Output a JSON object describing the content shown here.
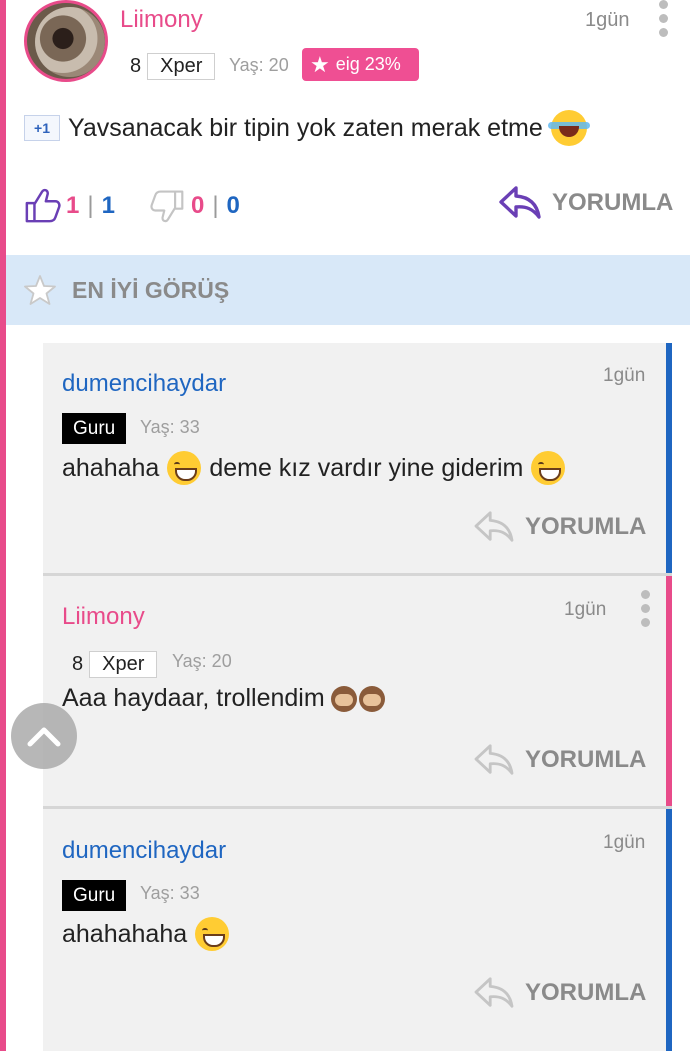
{
  "post": {
    "username": "Liimony",
    "time": "1gün",
    "level": "8",
    "rank": "Xper",
    "age": "Yaş: 20",
    "eig": "eig 23%",
    "plus_one": "+1",
    "text": "Yavsanacak bir tipin yok zaten merak etme",
    "likes_pink": "1",
    "likes_blue": "1",
    "dislikes_pink": "0",
    "dislikes_blue": "0",
    "separator": "|",
    "reply_label": "YORUMLA"
  },
  "best_opinion": {
    "label": "EN İYİ GÖRÜŞ"
  },
  "comments": [
    {
      "username": "dumencihaydar",
      "time": "1gün",
      "badge": "Guru",
      "age": "Yaş: 33",
      "text_a": "ahahaha",
      "text_b": "deme kız vardır yine giderim",
      "reply_label": "YORUMLA",
      "accent": "#1f66c1"
    },
    {
      "username": "Liimony",
      "time": "1gün",
      "level": "8",
      "rank": "Xper",
      "age": "Yaş: 20",
      "text": "Aaa haydaar, trollendim",
      "reply_label": "YORUMLA",
      "accent": "#e84b8a"
    },
    {
      "username": "dumencihaydar",
      "time": "1gün",
      "badge": "Guru",
      "age": "Yaş: 33",
      "text": "ahahahaha",
      "reply_label": "YORUMLA",
      "accent": "#1f66c1"
    }
  ],
  "icons": [
    "avatar",
    "more-icon",
    "star-icon",
    "like-icon",
    "dislike-icon",
    "reply-icon",
    "chevron-up-icon",
    "grin-emoji",
    "laugh-emoji",
    "monkey-emoji"
  ],
  "colors": {
    "pink": "#e84b8a",
    "blue": "#1f66c1",
    "banner": "#d8e8f8",
    "card": "#f1f1f1"
  }
}
